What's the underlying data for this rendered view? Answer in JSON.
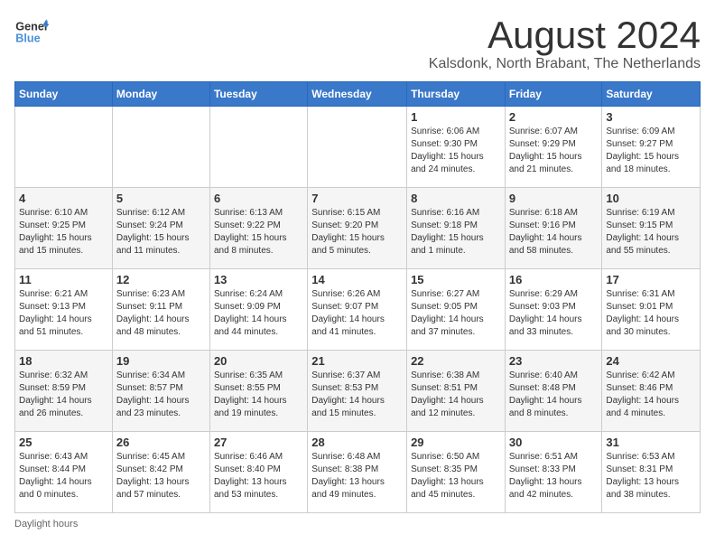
{
  "header": {
    "logo_general": "General",
    "logo_blue": "Blue",
    "month_title": "August 2024",
    "location": "Kalsdonk, North Brabant, The Netherlands"
  },
  "calendar": {
    "headers": [
      "Sunday",
      "Monday",
      "Tuesday",
      "Wednesday",
      "Thursday",
      "Friday",
      "Saturday"
    ],
    "weeks": [
      [
        {
          "day": "",
          "info": ""
        },
        {
          "day": "",
          "info": ""
        },
        {
          "day": "",
          "info": ""
        },
        {
          "day": "",
          "info": ""
        },
        {
          "day": "1",
          "info": "Sunrise: 6:06 AM\nSunset: 9:30 PM\nDaylight: 15 hours\nand 24 minutes."
        },
        {
          "day": "2",
          "info": "Sunrise: 6:07 AM\nSunset: 9:29 PM\nDaylight: 15 hours\nand 21 minutes."
        },
        {
          "day": "3",
          "info": "Sunrise: 6:09 AM\nSunset: 9:27 PM\nDaylight: 15 hours\nand 18 minutes."
        }
      ],
      [
        {
          "day": "4",
          "info": "Sunrise: 6:10 AM\nSunset: 9:25 PM\nDaylight: 15 hours\nand 15 minutes."
        },
        {
          "day": "5",
          "info": "Sunrise: 6:12 AM\nSunset: 9:24 PM\nDaylight: 15 hours\nand 11 minutes."
        },
        {
          "day": "6",
          "info": "Sunrise: 6:13 AM\nSunset: 9:22 PM\nDaylight: 15 hours\nand 8 minutes."
        },
        {
          "day": "7",
          "info": "Sunrise: 6:15 AM\nSunset: 9:20 PM\nDaylight: 15 hours\nand 5 minutes."
        },
        {
          "day": "8",
          "info": "Sunrise: 6:16 AM\nSunset: 9:18 PM\nDaylight: 15 hours\nand 1 minute."
        },
        {
          "day": "9",
          "info": "Sunrise: 6:18 AM\nSunset: 9:16 PM\nDaylight: 14 hours\nand 58 minutes."
        },
        {
          "day": "10",
          "info": "Sunrise: 6:19 AM\nSunset: 9:15 PM\nDaylight: 14 hours\nand 55 minutes."
        }
      ],
      [
        {
          "day": "11",
          "info": "Sunrise: 6:21 AM\nSunset: 9:13 PM\nDaylight: 14 hours\nand 51 minutes."
        },
        {
          "day": "12",
          "info": "Sunrise: 6:23 AM\nSunset: 9:11 PM\nDaylight: 14 hours\nand 48 minutes."
        },
        {
          "day": "13",
          "info": "Sunrise: 6:24 AM\nSunset: 9:09 PM\nDaylight: 14 hours\nand 44 minutes."
        },
        {
          "day": "14",
          "info": "Sunrise: 6:26 AM\nSunset: 9:07 PM\nDaylight: 14 hours\nand 41 minutes."
        },
        {
          "day": "15",
          "info": "Sunrise: 6:27 AM\nSunset: 9:05 PM\nDaylight: 14 hours\nand 37 minutes."
        },
        {
          "day": "16",
          "info": "Sunrise: 6:29 AM\nSunset: 9:03 PM\nDaylight: 14 hours\nand 33 minutes."
        },
        {
          "day": "17",
          "info": "Sunrise: 6:31 AM\nSunset: 9:01 PM\nDaylight: 14 hours\nand 30 minutes."
        }
      ],
      [
        {
          "day": "18",
          "info": "Sunrise: 6:32 AM\nSunset: 8:59 PM\nDaylight: 14 hours\nand 26 minutes."
        },
        {
          "day": "19",
          "info": "Sunrise: 6:34 AM\nSunset: 8:57 PM\nDaylight: 14 hours\nand 23 minutes."
        },
        {
          "day": "20",
          "info": "Sunrise: 6:35 AM\nSunset: 8:55 PM\nDaylight: 14 hours\nand 19 minutes."
        },
        {
          "day": "21",
          "info": "Sunrise: 6:37 AM\nSunset: 8:53 PM\nDaylight: 14 hours\nand 15 minutes."
        },
        {
          "day": "22",
          "info": "Sunrise: 6:38 AM\nSunset: 8:51 PM\nDaylight: 14 hours\nand 12 minutes."
        },
        {
          "day": "23",
          "info": "Sunrise: 6:40 AM\nSunset: 8:48 PM\nDaylight: 14 hours\nand 8 minutes."
        },
        {
          "day": "24",
          "info": "Sunrise: 6:42 AM\nSunset: 8:46 PM\nDaylight: 14 hours\nand 4 minutes."
        }
      ],
      [
        {
          "day": "25",
          "info": "Sunrise: 6:43 AM\nSunset: 8:44 PM\nDaylight: 14 hours\nand 0 minutes."
        },
        {
          "day": "26",
          "info": "Sunrise: 6:45 AM\nSunset: 8:42 PM\nDaylight: 13 hours\nand 57 minutes."
        },
        {
          "day": "27",
          "info": "Sunrise: 6:46 AM\nSunset: 8:40 PM\nDaylight: 13 hours\nand 53 minutes."
        },
        {
          "day": "28",
          "info": "Sunrise: 6:48 AM\nSunset: 8:38 PM\nDaylight: 13 hours\nand 49 minutes."
        },
        {
          "day": "29",
          "info": "Sunrise: 6:50 AM\nSunset: 8:35 PM\nDaylight: 13 hours\nand 45 minutes."
        },
        {
          "day": "30",
          "info": "Sunrise: 6:51 AM\nSunset: 8:33 PM\nDaylight: 13 hours\nand 42 minutes."
        },
        {
          "day": "31",
          "info": "Sunrise: 6:53 AM\nSunset: 8:31 PM\nDaylight: 13 hours\nand 38 minutes."
        }
      ]
    ]
  },
  "footer": {
    "daylight_label": "Daylight hours"
  }
}
